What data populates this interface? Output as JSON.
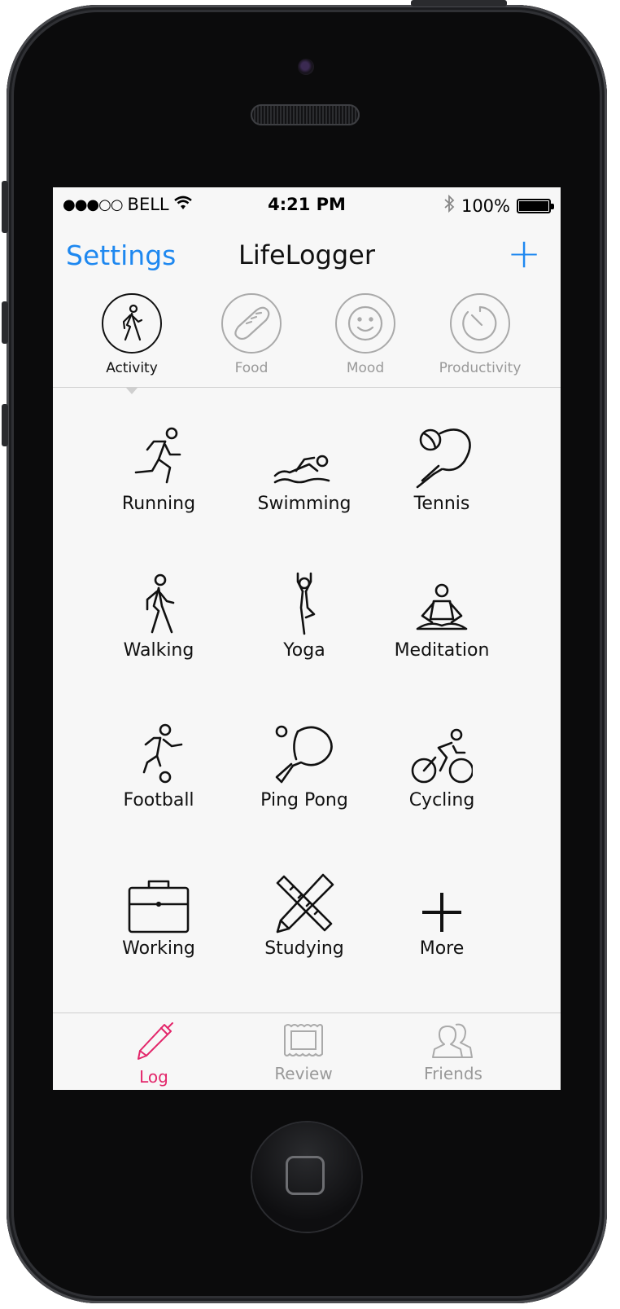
{
  "status_bar": {
    "signal": "●●●○○",
    "carrier": "BELL",
    "time": "4:21 PM",
    "battery": "100%"
  },
  "nav": {
    "left_label": "Settings",
    "title": "LifeLogger",
    "add_label": "+"
  },
  "categories": [
    {
      "label": "Activity",
      "icon": "walker-icon",
      "active": true
    },
    {
      "label": "Food",
      "icon": "bread-icon",
      "active": false
    },
    {
      "label": "Mood",
      "icon": "smiley-icon",
      "active": false
    },
    {
      "label": "Productivity",
      "icon": "gauge-icon",
      "active": false
    }
  ],
  "activities": [
    {
      "label": "Running",
      "icon": "running-icon"
    },
    {
      "label": "Swimming",
      "icon": "swimming-icon"
    },
    {
      "label": "Tennis",
      "icon": "tennis-icon"
    },
    {
      "label": "Walking",
      "icon": "walking-icon"
    },
    {
      "label": "Yoga",
      "icon": "yoga-icon"
    },
    {
      "label": "Meditation",
      "icon": "meditation-icon"
    },
    {
      "label": "Football",
      "icon": "football-icon"
    },
    {
      "label": "Ping Pong",
      "icon": "ping-pong-icon"
    },
    {
      "label": "Cycling",
      "icon": "cycling-icon"
    },
    {
      "label": "Working",
      "icon": "briefcase-icon"
    },
    {
      "label": "Studying",
      "icon": "pencil-ruler-icon"
    },
    {
      "label": "More",
      "icon": "plus-icon"
    }
  ],
  "tabs": [
    {
      "label": "Log",
      "icon": "pen-icon",
      "active": true
    },
    {
      "label": "Review",
      "icon": "picture-frame-icon",
      "active": false
    },
    {
      "label": "Friends",
      "icon": "people-icon",
      "active": false
    }
  ],
  "colors": {
    "accent": "#1e88f0",
    "tab_active": "#e3266a"
  }
}
